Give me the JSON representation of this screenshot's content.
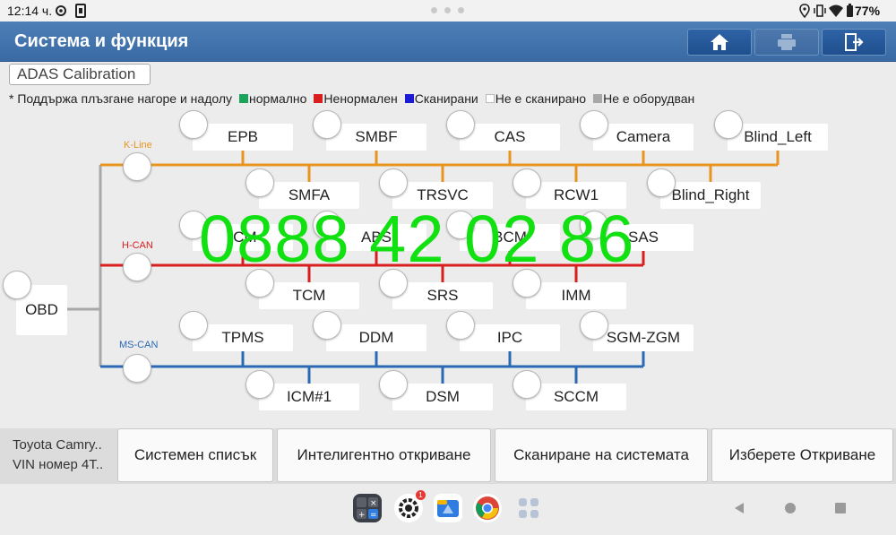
{
  "status": {
    "time": "12:14 ч.",
    "battery": "77%",
    "icons": [
      "settings-icon",
      "sim-icon",
      "location-icon",
      "vibrate-icon",
      "wifi-icon",
      "battery-icon"
    ]
  },
  "header": {
    "title": "Система и функция",
    "buttons": [
      "home-icon",
      "print-icon",
      "exit-icon"
    ]
  },
  "tab": {
    "label": "ADAS Calibration"
  },
  "legend": {
    "hint": "* Поддържа плъзгане нагоре и надолу",
    "items": [
      {
        "color": "#1aa35a",
        "label": "нормално"
      },
      {
        "color": "#d81e1e",
        "label": "Ненормален"
      },
      {
        "color": "#1b1bd6",
        "label": "Сканирани"
      },
      {
        "color": "#ffffff",
        "label": "Не е сканирано"
      },
      {
        "color": "#a8a8a8",
        "label": "Не е оборудван"
      }
    ]
  },
  "buses": {
    "kline": {
      "label": "K-Line",
      "color": "#e8951f"
    },
    "hcan": {
      "label": "H-CAN",
      "color": "#d81e1e"
    },
    "mscan": {
      "label": "MS-CAN",
      "color": "#2a6ab5"
    }
  },
  "gateway": {
    "label": "OBD"
  },
  "modules": {
    "kline_top": [
      "EPB",
      "SMBF",
      "CAS",
      "Camera",
      "Blind_Left"
    ],
    "kline_bottom": [
      "SMFA",
      "TRSVC",
      "RCW1",
      "Blind_Right"
    ],
    "hcan_top": [
      "ICM",
      "ABS",
      "BCM",
      "SAS"
    ],
    "hcan_bottom": [
      "TCM",
      "SRS",
      "IMM"
    ],
    "mscan_top": [
      "TPMS",
      "DDM",
      "IPC",
      "SGM-ZGM"
    ],
    "mscan_bottom": [
      "ICM#1",
      "DSM",
      "SCCM"
    ]
  },
  "watermark": "0888 42 02 86",
  "vehicle": {
    "line1": "Toyota Camry..",
    "line2": "VIN номер 4T.."
  },
  "bottom_buttons": [
    "Системен списък",
    "Интелигентно откриване",
    "Сканиране на системата",
    "Изберете Откриване"
  ],
  "dock": {
    "apps": [
      "calculator-icon",
      "settings-app-icon",
      "files-icon",
      "chrome-icon",
      "app-drawer-icon"
    ],
    "settings_badge": "1",
    "nav": [
      "back-icon",
      "home-nav-icon",
      "recents-icon"
    ]
  }
}
